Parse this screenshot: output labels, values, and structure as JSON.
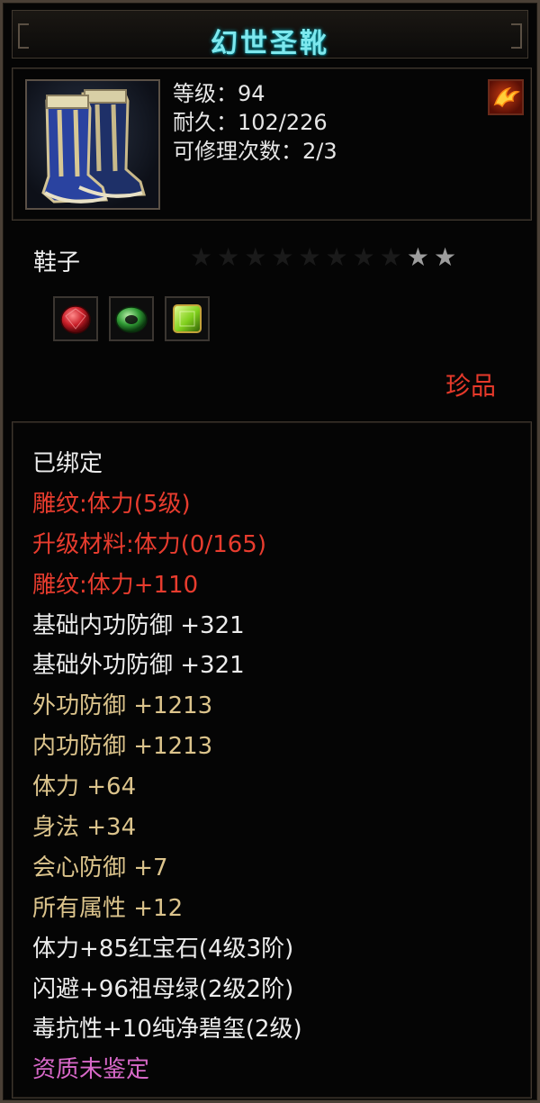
{
  "item": {
    "name": "幻世圣靴",
    "stats": [
      "等级：94",
      "耐久：102/226",
      "可修理次数：2/3"
    ],
    "category": "鞋子",
    "rarity": "珍品",
    "stars": {
      "filled": 2,
      "total": 10
    },
    "gems": [
      {
        "icon": "red-ruby-gem-icon",
        "color": "#c81e28"
      },
      {
        "icon": "green-jade-ring-icon",
        "color": "#2f9a34"
      },
      {
        "icon": "green-square-gem-icon",
        "color": "#7fcf1c"
      }
    ],
    "attributes": [
      {
        "text": "已绑定",
        "color": "white"
      },
      {
        "text": "雕纹:体力(5级)",
        "color": "red"
      },
      {
        "text": "升级材料:体力(0/165)",
        "color": "red"
      },
      {
        "text": "雕纹:体力+110",
        "color": "red"
      },
      {
        "text": "基础内功防御 +321",
        "color": "white"
      },
      {
        "text": "基础外功防御 +321",
        "color": "white"
      },
      {
        "text": "外功防御 +1213",
        "color": "gold"
      },
      {
        "text": "内功防御 +1213",
        "color": "gold"
      },
      {
        "text": "体力 +64",
        "color": "gold"
      },
      {
        "text": "身法 +34",
        "color": "gold"
      },
      {
        "text": "会心防御 +7",
        "color": "gold"
      },
      {
        "text": "所有属性 +12",
        "color": "gold"
      },
      {
        "text": "体力+85红宝石(4级3阶)",
        "color": "white"
      },
      {
        "text": "闪避+96祖母绿(2级2阶)",
        "color": "white"
      },
      {
        "text": "毒抗性+10纯净碧玺(2级)",
        "color": "white"
      },
      {
        "text": "资质未鉴定",
        "color": "purple"
      }
    ]
  },
  "icons": {
    "item": "blue-boots-icon",
    "badge": "flame-phoenix-badge-icon",
    "star": "star-icon"
  },
  "colors": {
    "title": "#7de8ee",
    "red": "#e83c2e",
    "gold": "#dcc48c",
    "purple": "#d768c8",
    "white": "#ececec",
    "border": "#4a4036"
  }
}
